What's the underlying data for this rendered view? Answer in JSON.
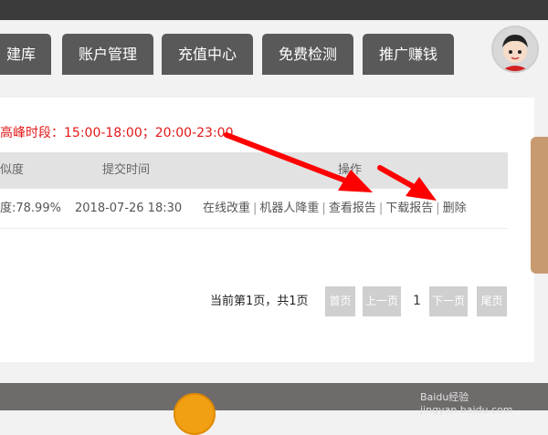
{
  "nav": {
    "tabs": [
      {
        "label": "建库"
      },
      {
        "label": "账户管理"
      },
      {
        "label": "充值中心"
      },
      {
        "label": "免费检测"
      },
      {
        "label": "推广赚钱"
      }
    ]
  },
  "notice": "高峰时段：15:00-18:00；20:00-23:00",
  "table": {
    "headers": [
      "似度",
      "提交时间",
      "操作"
    ],
    "rows": [
      {
        "similarity": "度:78.99%",
        "submitted": "2018-07-26 18:30",
        "actions": [
          "在线改重",
          "机器人降重",
          "查看报告",
          "下载报告",
          "删除"
        ],
        "separator": "|"
      }
    ]
  },
  "pager": {
    "summary": "当前第1页，共1页",
    "first": "首页",
    "prev": "上一页",
    "current": "1",
    "next": "下一页",
    "last": "尾页"
  },
  "watermark": {
    "brand": "Baidu经验",
    "url": "jingyan.baidu.com"
  },
  "colors": {
    "nav_tab_bg": "#595959",
    "notice_red": "#e31818",
    "pager_button": "#cfcfcf",
    "arrow_red": "#ff0000",
    "side_tab": "#c89a70",
    "footer": "#6f6b6b"
  },
  "icons": [
    "user-avatar-icon",
    "annotation-arrow-icon",
    "footer-mascot-icon"
  ]
}
